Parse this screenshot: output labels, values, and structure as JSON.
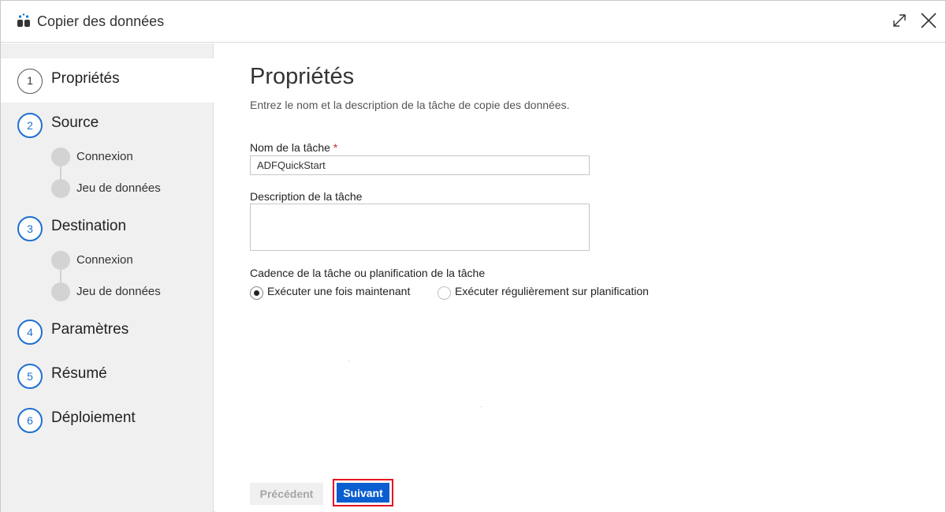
{
  "window": {
    "title": "Copier des données",
    "icon": "data-copy-icon",
    "maximize_icon": "maximize-icon",
    "close_icon": "close-icon"
  },
  "sidebar": {
    "steps": [
      {
        "number": "1",
        "label": "Propriétés",
        "active": true
      },
      {
        "number": "2",
        "label": "Source",
        "substeps": [
          "Connexion",
          "Jeu de données"
        ]
      },
      {
        "number": "3",
        "label": "Destination",
        "substeps": [
          "Connexion",
          "Jeu de données"
        ]
      },
      {
        "number": "4",
        "label": "Paramètres"
      },
      {
        "number": "5",
        "label": "Résumé"
      },
      {
        "number": "6",
        "label": "Déploiement"
      }
    ]
  },
  "main": {
    "title": "Propriétés",
    "subtitle": "Entrez le nom et la description de la tâche de copie des données.",
    "task_name": {
      "label": "Nom de la tâche",
      "required_marker": "*",
      "value": "ADFQuickStart"
    },
    "task_description": {
      "label": "Description de la tâche",
      "value": ""
    },
    "cadence": {
      "label": "Cadence de la tâche ou planification de la tâche",
      "options": [
        {
          "label": "Exécuter une fois maintenant",
          "selected": true
        },
        {
          "label": "Exécuter régulièrement sur planification",
          "selected": false
        }
      ]
    },
    "buttons": {
      "previous": "Précédent",
      "next": "Suivant"
    }
  },
  "colors": {
    "accent": "#0b5ed0",
    "step_circle": "#1f6fd1",
    "highlight_outline": "#e81123",
    "sidebar_bg": "#f0f0f0"
  }
}
